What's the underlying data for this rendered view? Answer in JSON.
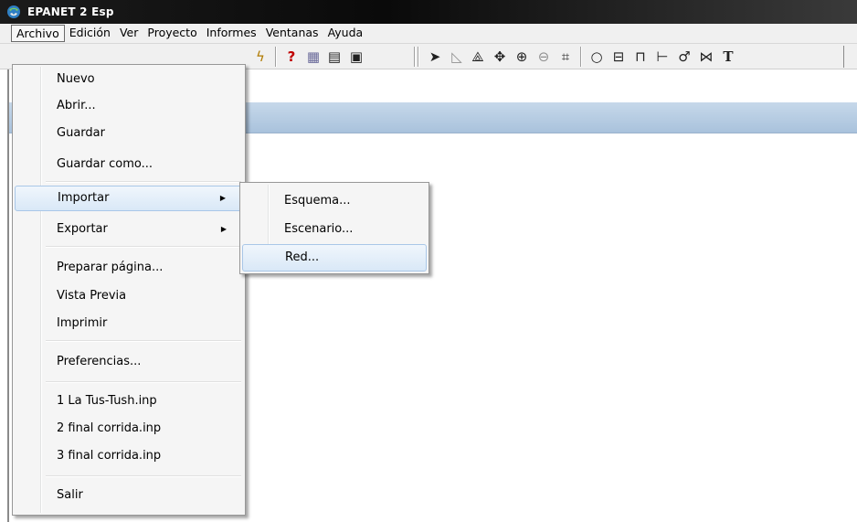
{
  "window": {
    "title": "EPANET 2 Esp",
    "app_icon": "epanet-app-icon"
  },
  "menubar": {
    "items": [
      {
        "label": "Archivo",
        "active": true
      },
      {
        "label": "Edición"
      },
      {
        "label": "Ver"
      },
      {
        "label": "Proyecto"
      },
      {
        "label": "Informes"
      },
      {
        "label": "Ventanas"
      },
      {
        "label": "Ayuda"
      }
    ]
  },
  "toolbar": {
    "buttons": [
      {
        "icon": "run-lightning-icon",
        "glyph": "ϟ"
      },
      {
        "icon": "query-icon",
        "glyph": "?"
      },
      {
        "icon": "graph-icon",
        "glyph": "▦"
      },
      {
        "icon": "table-icon",
        "glyph": "▤"
      },
      {
        "icon": "options-icon",
        "glyph": "▣"
      },
      {
        "icon": "select-object-icon",
        "glyph": "➤"
      },
      {
        "icon": "select-vertex-icon",
        "glyph": "◺"
      },
      {
        "icon": "select-region-icon",
        "glyph": "⟁"
      },
      {
        "icon": "pan-icon",
        "glyph": "✥"
      },
      {
        "icon": "zoom-in-icon",
        "glyph": "⊕"
      },
      {
        "icon": "zoom-out-icon",
        "glyph": "⊖"
      },
      {
        "icon": "full-extent-icon",
        "glyph": "⌗"
      },
      {
        "icon": "add-junction-icon",
        "glyph": "○"
      },
      {
        "icon": "add-reservoir-icon",
        "glyph": "⊟"
      },
      {
        "icon": "add-tank-icon",
        "glyph": "⊓"
      },
      {
        "icon": "add-pipe-icon",
        "glyph": "⊢"
      },
      {
        "icon": "add-pump-icon",
        "glyph": "♂"
      },
      {
        "icon": "add-valve-icon",
        "glyph": "⋈"
      },
      {
        "icon": "add-label-icon",
        "glyph": "T"
      }
    ]
  },
  "file_menu": {
    "items": {
      "nuevo": "Nuevo",
      "abrir": "Abrir...",
      "guardar": "Guardar",
      "guardar_como": "Guardar como...",
      "importar": "Importar",
      "exportar": "Exportar",
      "preparar_pagina": "Preparar página...",
      "vista_previa": "Vista Previa",
      "imprimir": "Imprimir",
      "preferencias": "Preferencias...",
      "recent_1": "1 La Tus-Tush.inp",
      "recent_2": "2 final corrida.inp",
      "recent_3": "3 final corrida.inp",
      "salir": "Salir"
    },
    "submenu_arrow": "▶"
  },
  "import_submenu": {
    "esquema": "Esquema...",
    "escenario": "Escenario...",
    "red": "Red..."
  },
  "colors": {
    "titlebar": "#0a0a0a",
    "menu_bg": "#f5f5f5",
    "highlight": "#d9e8f7",
    "child_header": "#b3cadf"
  }
}
